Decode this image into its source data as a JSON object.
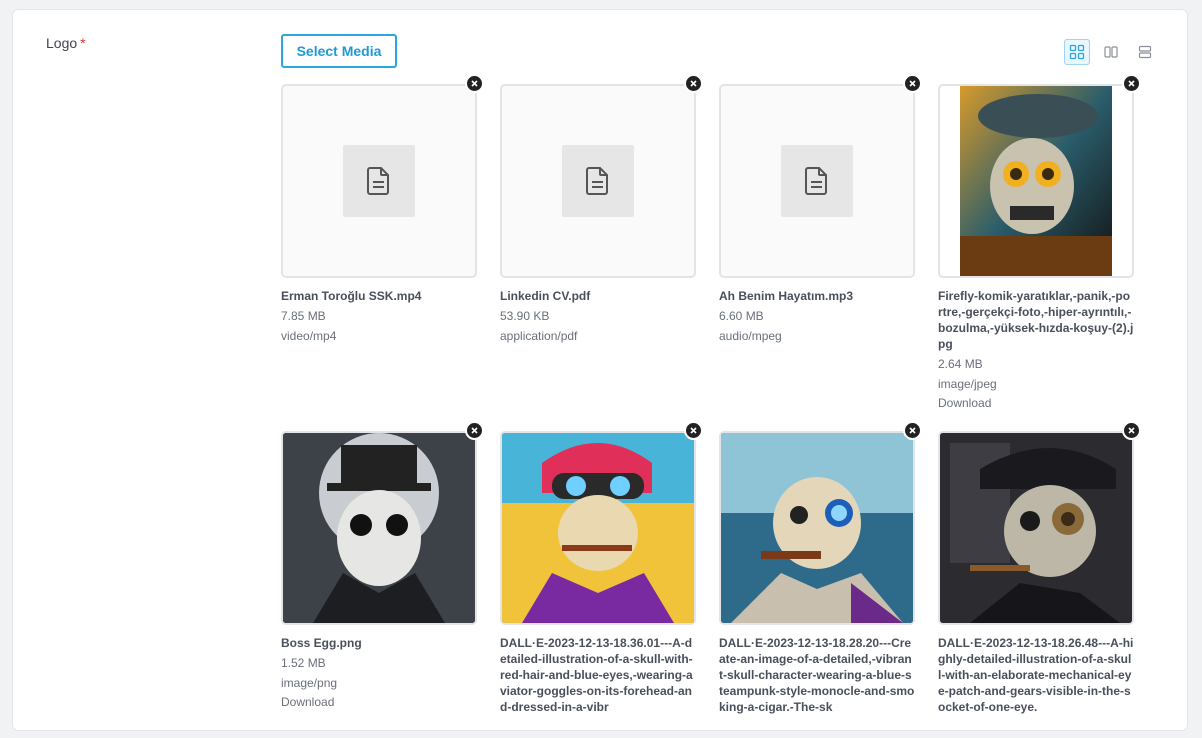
{
  "field": {
    "label": "Logo",
    "required_mark": "*"
  },
  "select_button": "Select Media",
  "view_modes": [
    "grid-view-icon",
    "columns-view-icon",
    "list-view-icon"
  ],
  "accent_color": "#27a6df",
  "items": [
    {
      "name": "Erman Toroğlu SSK.mp4",
      "size": "7.85 MB",
      "type": "video/mp4"
    },
    {
      "name": "Linkedin CV.pdf",
      "size": "53.90 KB",
      "type": "application/pdf"
    },
    {
      "name": "Ah Benim Hayatım.mp3",
      "size": "6.60 MB",
      "type": "audio/mpeg"
    },
    {
      "name": "Firefly-komik-yaratıklar,-panik,-portre,-gerçekçi-foto,-hiper-ayrıntılı,-bozulma,-yüksek-hızda-koşuy-(2).jpg",
      "size": "2.64 MB",
      "type": "image/jpeg",
      "download": "Download"
    },
    {
      "name": "Boss Egg.png",
      "size": "1.52 MB",
      "type": "image/png",
      "download": "Download"
    },
    {
      "name": "DALL·E-2023-12-13-18.36.01---A-detailed-illustration-of-a-skull-with-red-hair-and-blue-eyes,-wearing-aviator-goggles-on-its-forehead-and-dressed-in-a-vibr"
    },
    {
      "name": "DALL·E-2023-12-13-18.28.20---Create-an-image-of-a-detailed,-vibrant-skull-character-wearing-a-blue-steampunk-style-monocle-and-smoking-a-cigar.-The-sk"
    },
    {
      "name": "DALL·E-2023-12-13-18.26.48---A-highly-detailed-illustration-of-a-skull-with-an-elaborate-mechanical-eye-patch-and-gears-visible-in-the-socket-of-one-eye."
    }
  ]
}
